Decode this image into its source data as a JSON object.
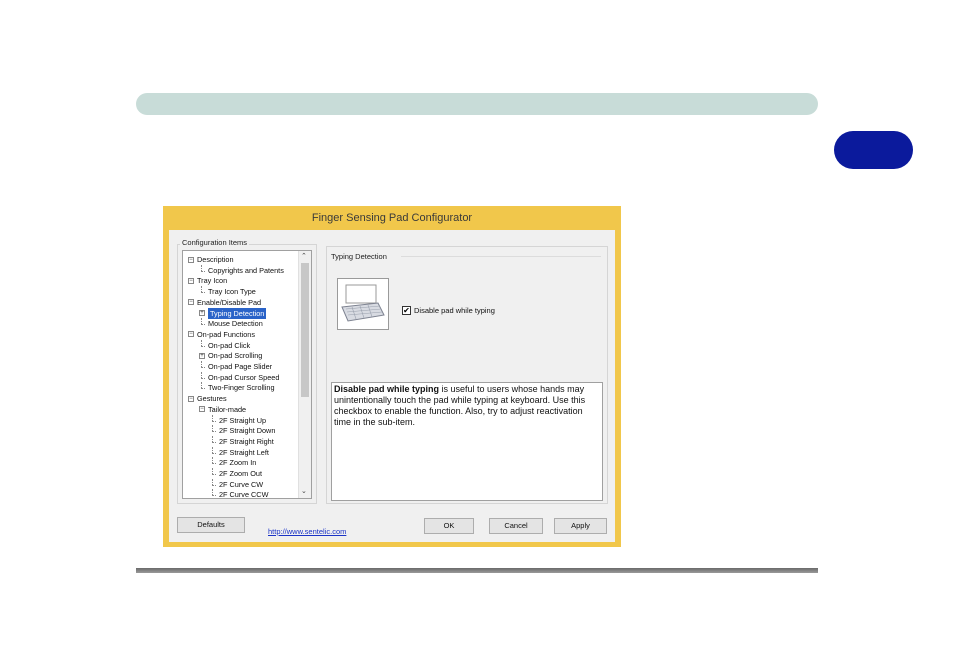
{
  "dialog": {
    "title": "Finger Sensing Pad Configurator",
    "config_items_label": "Configuration Items",
    "tree": [
      {
        "label": "Description",
        "indent": 0,
        "expander": "minus"
      },
      {
        "label": "Copyrights and Patents",
        "indent": 1,
        "expander": null
      },
      {
        "label": "Tray Icon",
        "indent": 0,
        "expander": "minus"
      },
      {
        "label": "Tray Icon Type",
        "indent": 1,
        "expander": null
      },
      {
        "label": "Enable/Disable Pad",
        "indent": 0,
        "expander": "minus"
      },
      {
        "label": "Typing Detection",
        "indent": 1,
        "expander": "plus",
        "selected": true
      },
      {
        "label": "Mouse Detection",
        "indent": 1,
        "expander": null
      },
      {
        "label": "On-pad Functions",
        "indent": 0,
        "expander": "minus"
      },
      {
        "label": "On-pad Click",
        "indent": 1,
        "expander": null
      },
      {
        "label": "On-pad Scrolling",
        "indent": 1,
        "expander": "plus"
      },
      {
        "label": "On-pad Page Slider",
        "indent": 1,
        "expander": null
      },
      {
        "label": "On-pad Cursor Speed",
        "indent": 1,
        "expander": null
      },
      {
        "label": "Two-Finger Scrolling",
        "indent": 1,
        "expander": null
      },
      {
        "label": "Gestures",
        "indent": 0,
        "expander": "minus"
      },
      {
        "label": "Tailor-made",
        "indent": 1,
        "expander": "minus"
      },
      {
        "label": "2F Straight Up",
        "indent": 2,
        "expander": null
      },
      {
        "label": "2F Straight Down",
        "indent": 2,
        "expander": null
      },
      {
        "label": "2F Straight Right",
        "indent": 2,
        "expander": null
      },
      {
        "label": "2F Straight Left",
        "indent": 2,
        "expander": null
      },
      {
        "label": "2F Zoom In",
        "indent": 2,
        "expander": null
      },
      {
        "label": "2F Zoom Out",
        "indent": 2,
        "expander": null
      },
      {
        "label": "2F Curve CW",
        "indent": 2,
        "expander": null
      },
      {
        "label": "2F Curve CCW",
        "indent": 2,
        "expander": null
      }
    ],
    "section_title": "Typing Detection",
    "checkbox_label": "Disable pad while typing",
    "checkbox_checked": true,
    "description_bold": "Disable pad while typing",
    "description_text": " is useful to users whose hands may unintentionally touch the pad while typing at keyboard. Use this checkbox to enable the function. Also, try to adjust reactivation time in the sub-item.",
    "buttons": {
      "defaults": "Defaults",
      "ok": "OK",
      "cancel": "Cancel",
      "apply": "Apply"
    },
    "link": "http://www.sentelic.com"
  },
  "colors": {
    "header_bar": "#c8dcd8",
    "chapter_tab": "#0b1a9c",
    "dialog_frame": "#f1c74b",
    "selection": "#2a63c8"
  }
}
